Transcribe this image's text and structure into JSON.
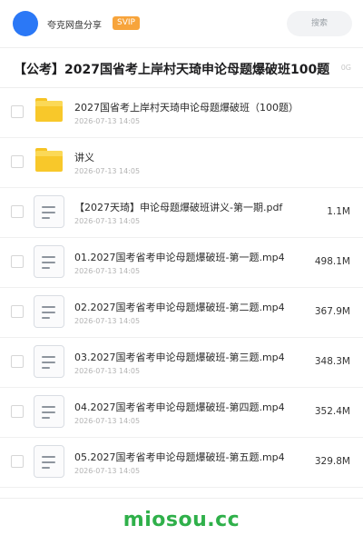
{
  "header": {
    "app_name": "夸克网盘分享",
    "badge": "SVIP",
    "search_placeholder": "搜索"
  },
  "title": {
    "text": "【公考】2027国省考上岸村天琦申论母题爆破班100题",
    "meta": "0G"
  },
  "files": [
    {
      "type": "folder",
      "name": "2027国省考上岸村天琦申论母题爆破班（100题）",
      "date": "2026-07-13 14:05",
      "size": ""
    },
    {
      "type": "folder",
      "name": "讲义",
      "date": "2026-07-13 14:05",
      "size": ""
    },
    {
      "type": "file",
      "name": "【2027天琦】申论母题爆破班讲义-第一期.pdf",
      "date": "2026-07-13 14:05",
      "size": "1.1M"
    },
    {
      "type": "file",
      "name": "01.2027国考省考申论母题爆破班-第一题.mp4",
      "date": "2026-07-13 14:05",
      "size": "498.1M"
    },
    {
      "type": "file",
      "name": "02.2027国考省考申论母题爆破班-第二题.mp4",
      "date": "2026-07-13 14:05",
      "size": "367.9M"
    },
    {
      "type": "file",
      "name": "03.2027国考省考申论母题爆破班-第三题.mp4",
      "date": "2026-07-13 14:05",
      "size": "348.3M"
    },
    {
      "type": "file",
      "name": "04.2027国考省考申论母题爆破班-第四题.mp4",
      "date": "2026-07-13 14:05",
      "size": "352.4M"
    },
    {
      "type": "file",
      "name": "05.2027国考省考申论母题爆破班-第五题.mp4",
      "date": "2026-07-13 14:05",
      "size": "329.8M"
    }
  ],
  "footer": {
    "brand": "miosou.cc"
  },
  "colors": {
    "accent": "#2b78f6",
    "badge": "#f7a43b",
    "folder": "#f8c82a",
    "brand": "#2fb04a"
  },
  "icons": {
    "folder": "folder-icon",
    "file": "document-icon"
  }
}
